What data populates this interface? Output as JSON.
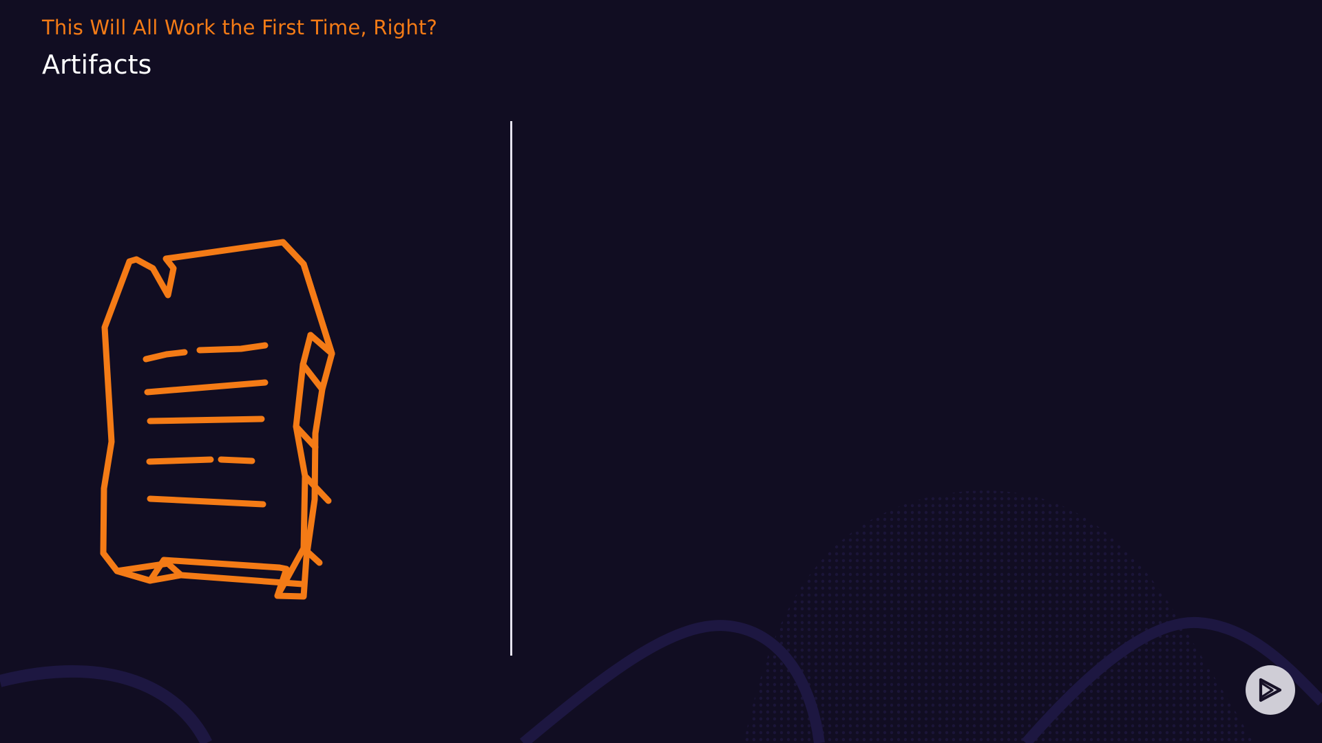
{
  "slide": {
    "subtitle": "This Will All Work the First Time, Right?",
    "title": "Artifacts"
  },
  "colors": {
    "background": "#110d22",
    "accent": "#f47b16",
    "title": "#ffffff",
    "divider": "#e6e3ef",
    "background_pattern": "#231c4a"
  },
  "icons": {
    "illustration": "document-scroll-icon",
    "player": "play-logo-icon"
  }
}
